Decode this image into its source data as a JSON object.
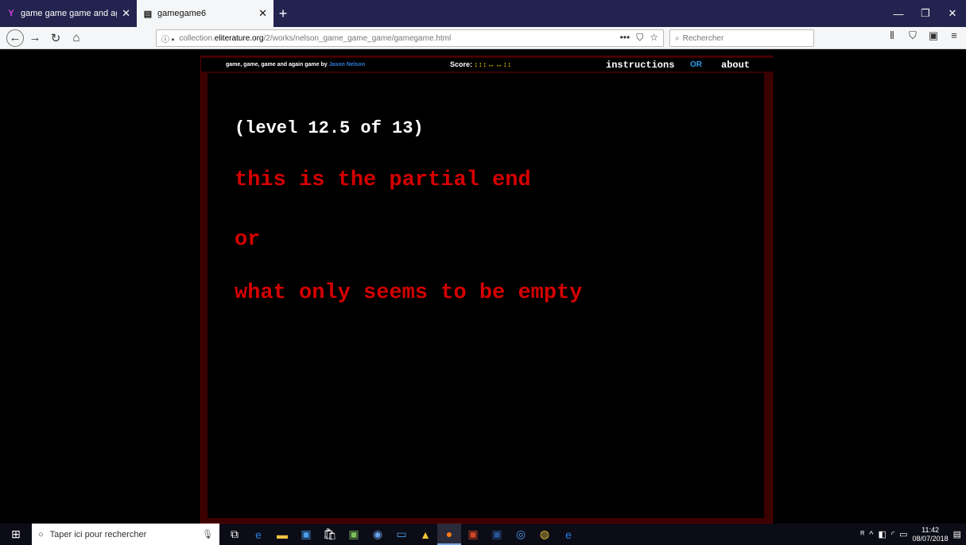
{
  "browser": {
    "tabs": [
      {
        "title": "game game game and again g…",
        "icon": "Y"
      },
      {
        "title": "gamegame6",
        "icon": "doc"
      }
    ],
    "url_prefix": "collection.",
    "url_host": "eliterature.org",
    "url_path": "/2/works/nelson_game_game_game/gamegame.html",
    "search_placeholder": "Rechercher"
  },
  "game": {
    "title": "game, game, game and again game",
    "by": "by",
    "author": "Jason Nelson",
    "score_label": "Score:",
    "score_value": "↕↕↕↔↔↕↕",
    "instructions": "instructions",
    "or": "OR",
    "about": "about",
    "level": "(level 12.5 of 13)",
    "line1": "this is the partial end",
    "line2": "or",
    "line3": "what only seems to be empty",
    "colors": {
      "frame": "#3b0000",
      "red_text": "#d40000",
      "score": "#f0d600",
      "link": "#2a9cf0"
    }
  },
  "taskbar": {
    "search_placeholder": "Taper ici pour rechercher",
    "time": "11:42",
    "date": "08/07/2018"
  }
}
